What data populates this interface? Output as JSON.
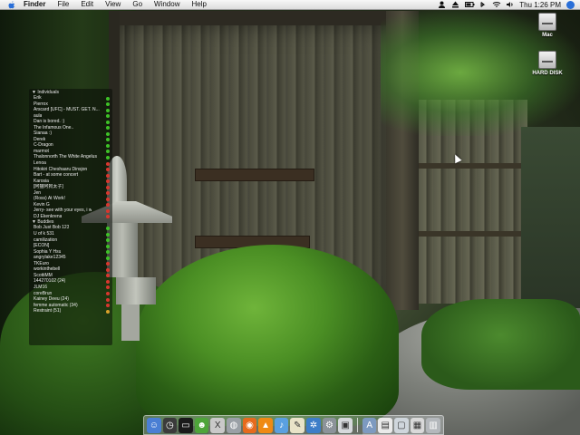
{
  "menubar": {
    "app_name": "Finder",
    "menus": [
      "File",
      "Edit",
      "View",
      "Go",
      "Window",
      "Help"
    ],
    "clock": "Thu 1:26 PM"
  },
  "desktop": {
    "icons": [
      {
        "label": "Mac",
        "icon": "hard-drive-icon"
      },
      {
        "label": "HARD DISK",
        "icon": "hard-drive-icon"
      }
    ]
  },
  "buddy_list": {
    "groups": [
      {
        "label": "▼ Individuals",
        "buddies": [
          {
            "name": "Erik",
            "status": "available"
          },
          {
            "name": "Pierrox",
            "status": "available"
          },
          {
            "name": "Arscard [UFC] - MUST. GET. N...",
            "status": "available"
          },
          {
            "name": "aula",
            "status": "available"
          },
          {
            "name": "Dan is bored. :)",
            "status": "available"
          },
          {
            "name": "The Infamous One..",
            "status": "available"
          },
          {
            "name": "Sianaa :)",
            "status": "available"
          },
          {
            "name": "Derek",
            "status": "available"
          },
          {
            "name": "C-Dragon",
            "status": "available"
          },
          {
            "name": "marmot",
            "status": "available"
          },
          {
            "name": "Thalonnorth The White Angelus",
            "status": "available"
          },
          {
            "name": "Lenoa",
            "status": "away"
          },
          {
            "name": "Hitokiri Cheshaaru Dinsjon",
            "status": "away"
          },
          {
            "name": "Bart - at some concert",
            "status": "away"
          },
          {
            "name": "Karosia",
            "status": "away"
          },
          {
            "name": "[阿猫阿狗太子]",
            "status": "away"
          },
          {
            "name": "Jen",
            "status": "away"
          },
          {
            "name": "(Ross) At Work!",
            "status": "away"
          },
          {
            "name": "Kevin G",
            "status": "away"
          },
          {
            "name": "Jerry- see with your eyes, i w",
            "status": "away"
          },
          {
            "name": "DJ Ekenkrena",
            "status": "away"
          }
        ]
      },
      {
        "label": "▼ Buddies",
        "buddies": [
          {
            "name": "Bob Just Bob 123",
            "status": "available"
          },
          {
            "name": "U of k 531",
            "status": "available"
          },
          {
            "name": "camilization",
            "status": "available"
          },
          {
            "name": "[ECON]",
            "status": "available"
          },
          {
            "name": "Sophia Y Hsu",
            "status": "available"
          },
          {
            "name": "angrylake12345",
            "status": "available"
          },
          {
            "name": "TKEuro",
            "status": "away"
          },
          {
            "name": "workinthebell",
            "status": "away"
          },
          {
            "name": "ScottiMM",
            "status": "away"
          },
          {
            "name": "144270102 (24)",
            "status": "away"
          },
          {
            "name": "JLM16",
            "status": "away"
          },
          {
            "name": "coreBrun",
            "status": "away"
          },
          {
            "name": "Kainey Deeu (24)",
            "status": "away"
          },
          {
            "name": "femme automatic (34)",
            "status": "away"
          },
          {
            "name": "Restraint (51)",
            "status": "idle"
          }
        ]
      }
    ]
  },
  "dock": {
    "items": [
      {
        "icon": "finder-icon",
        "color": "#4a7fd4"
      },
      {
        "icon": "dashboard-icon",
        "color": "#3b3b3b"
      },
      {
        "icon": "terminal-icon",
        "color": "#1a1a1a"
      },
      {
        "icon": "alien-icon",
        "color": "#4ea43a"
      },
      {
        "icon": "x11-icon",
        "color": "#c9c9c9"
      },
      {
        "icon": "disk-utility-icon",
        "color": "#9aa0a6"
      },
      {
        "icon": "firefox-icon",
        "color": "#e66a1d"
      },
      {
        "icon": "vlc-icon",
        "color": "#ef8a14"
      },
      {
        "icon": "itunes-icon",
        "color": "#5aa0e0"
      },
      {
        "icon": "textedit-icon",
        "color": "#e9e3c8"
      },
      {
        "icon": "network-icon",
        "color": "#3d7ec8"
      },
      {
        "icon": "system-preferences-icon",
        "color": "#8c939a"
      },
      {
        "icon": "preview-icon",
        "color": "#d6d9dc"
      },
      {
        "icon": "separator",
        "color": ""
      },
      {
        "icon": "applications-folder-icon",
        "color": "#7d9ac0"
      },
      {
        "icon": "document-icon",
        "color": "#eaeaea"
      },
      {
        "icon": "window-icon",
        "color": "#cfd6dc"
      },
      {
        "icon": "screenshot-icon",
        "color": "#d9d9d9"
      },
      {
        "icon": "trash-icon",
        "color": "#b4b8bc"
      }
    ]
  }
}
